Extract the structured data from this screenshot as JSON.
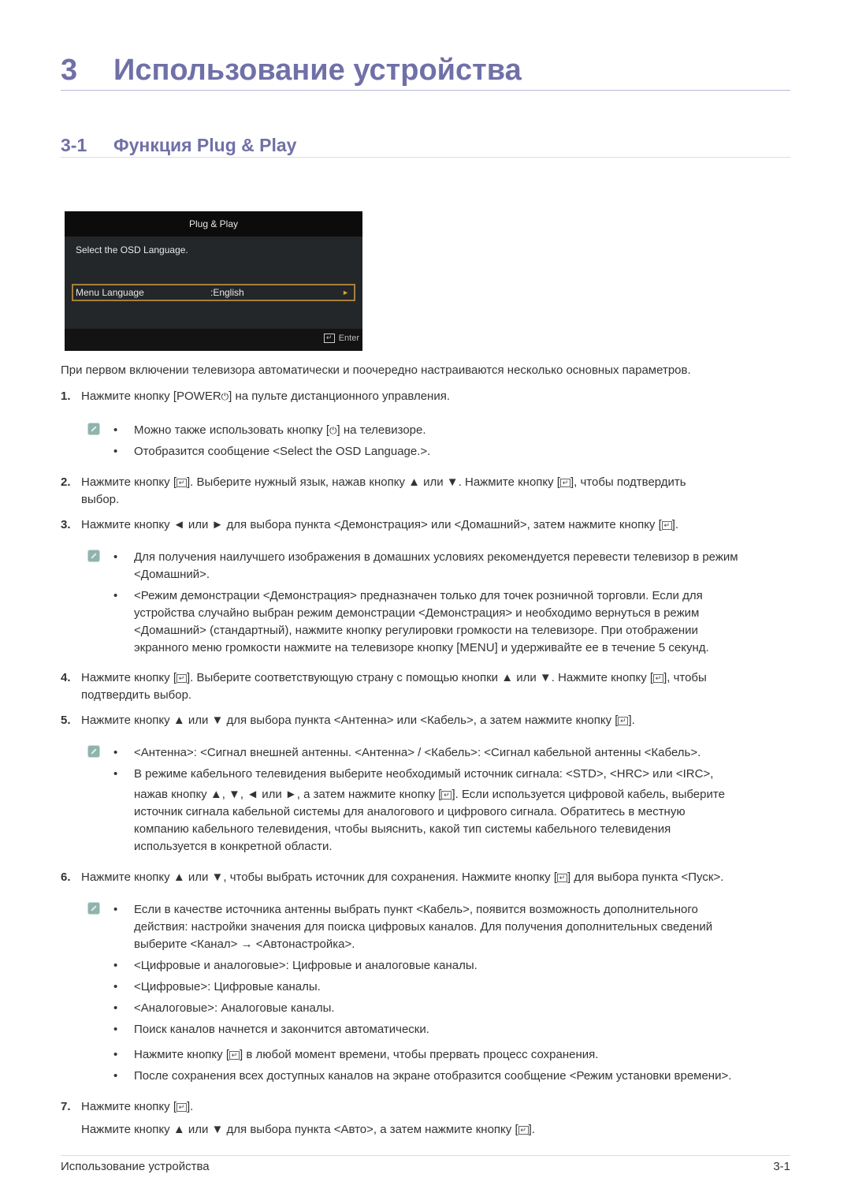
{
  "chapter": {
    "number": "3",
    "title": "Использование устройства"
  },
  "section": {
    "number": "3-1",
    "title": "Функция Plug & Play"
  },
  "osd": {
    "title": "Plug & Play",
    "subtitle": "Select the OSD Language.",
    "row_label": "Menu Language",
    "row_value": ":English",
    "row_arrow": "►",
    "enter_label": "Enter"
  },
  "intro": "При первом включении телевизора автоматически и поочередно настраиваются несколько основных параметров.",
  "steps": {
    "s1": {
      "num": "1.",
      "a": "Нажмите кнопку [POWER",
      "power": "⏻",
      "b": "] на пульте дистанционного управления."
    },
    "s1n": {
      "n1a": "Можно также использовать кнопку [",
      "n1p": "⏻",
      "n1b": "] на телевизоре.",
      "n2": "Отобразится сообщение <Select the OSD Language.>."
    },
    "s2": {
      "num": "2.",
      "a": "Нажмите кнопку [",
      "b": "]. Выберите нужный язык, нажав кнопку ▲ или ▼. Нажмите кнопку [",
      "c": "], чтобы подтвердить",
      "d": "выбор."
    },
    "s3": {
      "num": "3.",
      "a": "Нажмите кнопку ◄ или ► для выбора пункта <Демонстрация> или <Домашний>, затем нажмите кнопку [",
      "b": "]."
    },
    "s3n": {
      "n1a": "Для получения наилучшего изображения в домашних условиях рекомендуется перевести телевизор в режим",
      "n1b": "<Домашний>.",
      "n2a": "<Режим демонстрации <Демонстрация> предназначен только для точек розничной торговли. Если для",
      "n2b": "устройства случайно выбран режим демонстрации <Демонстрация> и необходимо вернуться в режим",
      "n2c": "<Домашний> (стандартный), нажмите кнопку регулировки громкости на телевизоре. При отображении",
      "n2d": "экранного меню громкости нажмите на телевизоре кнопку [MENU] и удерживайте ее в течение 5 секунд."
    },
    "s4": {
      "num": "4.",
      "a": "Нажмите кнопку [",
      "b": "]. Выберите соответствующую страну с помощью кнопки ▲ или ▼. Нажмите кнопку [",
      "c": "], чтобы",
      "d": "подтвердить выбор."
    },
    "s5": {
      "num": "5.",
      "a": "Нажмите кнопку ▲ или ▼ для выбора пункта <Антенна> или <Кабель>, а затем нажмите кнопку [",
      "b": "]."
    },
    "s5n": {
      "n1": "<Антенна>: <Сигнал внешней антенны. <Антенна> / <Кабель>: <Сигнал кабельной антенны <Кабель>.",
      "n2a": "В режиме кабельного телевидения выберите необходимый источник сигнала: <STD>, <HRC> или <IRC>,",
      "n2b1": "нажав кнопку ▲, ▼, ◄ или ►, а затем нажмите кнопку [",
      "n2b2": "]. Если используется цифровой кабель, выберите",
      "n2c": "источник сигнала кабельной системы для аналогового и цифрового сигнала. Обратитесь в местную",
      "n2d": "компанию кабельного телевидения, чтобы выяснить, какой тип системы кабельного телевидения",
      "n2e": "используется в конкретной области."
    },
    "s6": {
      "num": "6.",
      "a": "Нажмите кнопку ▲ или ▼, чтобы выбрать источник для сохранения. Нажмите кнопку [",
      "b": "] для выбора пункта <Пуск>."
    },
    "s6n": {
      "n1a": "Если в качестве источника антенны выбрать пункт <Кабель>, появится возможность дополнительного",
      "n1b": "действия: настройки значения для поиска цифровых каналов. Для получения дополнительных сведений",
      "n1c": "выберите <Канал> → <Автонастройка>.",
      "n2": "<Цифровые и аналоговые>: Цифровые и аналоговые каналы.",
      "n3": "<Цифровые>: Цифровые каналы.",
      "n4": "<Аналоговые>: Аналоговые каналы.",
      "n5": "Поиск каналов начнется и закончится автоматически.",
      "n6a": "Нажмите кнопку [",
      "n6b": "] в любой момент времени, чтобы прервать процесс сохранения.",
      "n7": "После сохранения всех доступных каналов на экране отобразится сообщение <Режим установки времени>."
    },
    "s7": {
      "num": "7.",
      "a": "Нажмите кнопку [",
      "b": "].",
      "c": "Нажмите кнопку ▲ или ▼ для выбора пункта <Авто>, а затем нажмите кнопку [",
      "d": "]."
    }
  },
  "bullet_char": "•",
  "enter_glyph": "↵",
  "footer": {
    "left": "Использование устройства",
    "right": "3-1"
  }
}
